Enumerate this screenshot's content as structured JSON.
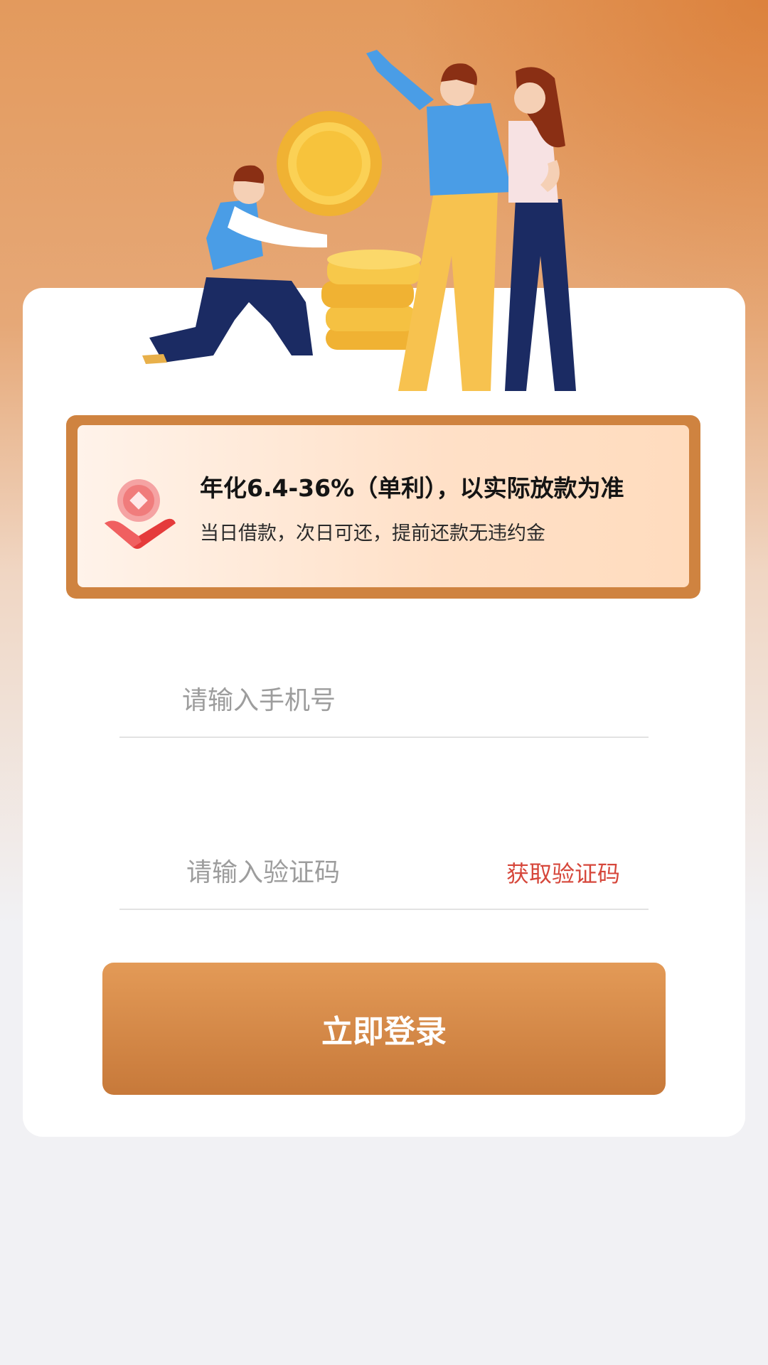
{
  "rate_banner": {
    "title": "年化6.4-36%（单利），以实际放款为准",
    "subtitle": "当日借款，次日可还，提前还款无违约金",
    "icon": "loan-coin-icon"
  },
  "form": {
    "phone_placeholder": "请输入手机号",
    "code_placeholder": "请输入验证码",
    "get_code_label": "获取验证码",
    "submit_label": "立即登录"
  },
  "colors": {
    "accent": "#cf8340",
    "link": "#d6473b"
  }
}
